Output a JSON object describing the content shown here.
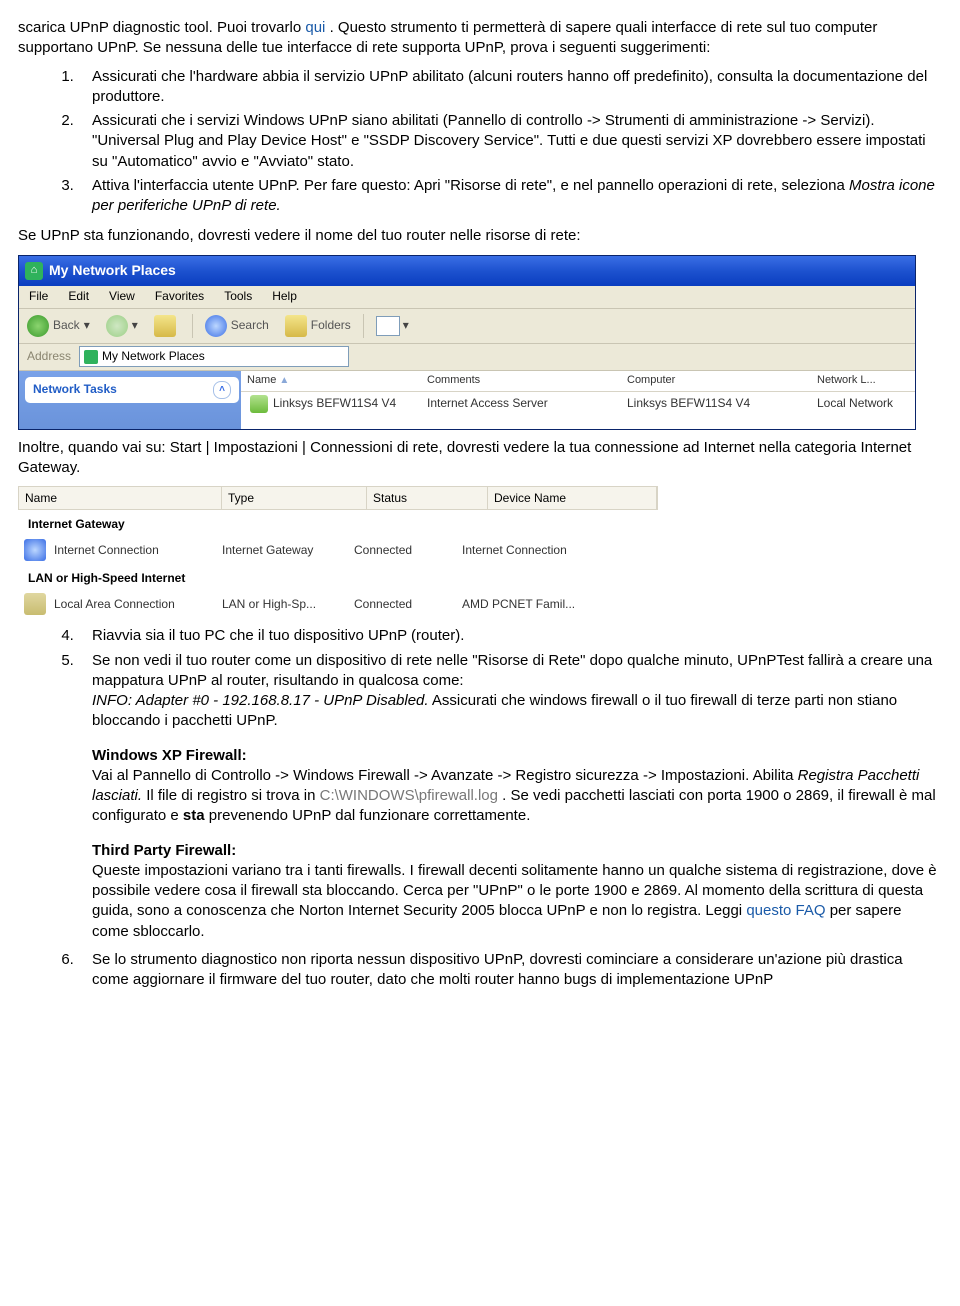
{
  "intro": {
    "part1": "scarica UPnP diagnostic tool. Puoi trovarlo ",
    "link": "qui",
    "part2": ". Questo strumento ti permetterà di sapere quali interfacce di rete sul tuo computer supportano UPnP. Se nessuna delle tue interfacce di rete supporta UPnP, prova i seguenti suggerimenti:"
  },
  "steps": {
    "s1": "Assicurati che l'hardware abbia il servizio UPnP abilitato (alcuni routers hanno off predefinito), consulta la documentazione del produttore.",
    "s2": "Assicurati che i servizi Windows UPnP siano abilitati (Pannello di controllo -> Strumenti di amministrazione -> Servizi). \"Universal Plug and Play Device Host\" e \"SSDP Discovery Service\". Tutti e due questi servizi XP dovrebbero essere impostati su \"Automatico\" avvio e \"Avviato\" stato.",
    "s3a": "Attiva l'interfaccia utente UPnP. Per fare questo: Apri \"Risorse di rete\", e nel pannello operazioni di rete, seleziona ",
    "s3b": "Mostra icone per periferiche UPnP di rete."
  },
  "after_steps": "Se UPnP sta funzionando, dovresti vedere il nome del tuo router nelle risorse di rete:",
  "xp": {
    "title": "My Network Places",
    "menu": [
      "File",
      "Edit",
      "View",
      "Favorites",
      "Tools",
      "Help"
    ],
    "back": "Back",
    "search": "Search",
    "folders": "Folders",
    "address_label": "Address",
    "address_value": "My Network Places",
    "sidebar_title": "Network Tasks",
    "cols": [
      "Name",
      "Comments",
      "Computer",
      "Network L..."
    ],
    "row": {
      "name": "Linksys BEFW11S4 V4",
      "comments": "Internet Access Server",
      "computer": "Linksys BEFW11S4 V4",
      "network": "Local Network"
    }
  },
  "middle_text": "Inoltre, quando vai su: Start | Impostazioni | Connessioni di rete, dovresti vedere la tua connessione ad Internet nella categoria Internet Gateway.",
  "nc": {
    "cols": [
      "Name",
      "Type",
      "Status",
      "Device Name"
    ],
    "cat1": "Internet Gateway",
    "row1": [
      "Internet Connection",
      "Internet Gateway",
      "Connected",
      "Internet Connection"
    ],
    "cat2": "LAN or High-Speed Internet",
    "row2": [
      "Local Area Connection",
      "LAN or High-Sp...",
      "Connected",
      "AMD PCNET Famil..."
    ]
  },
  "steps2": {
    "s4": "Riavvia sia il tuo PC che il tuo dispositivo UPnP (router).",
    "s5a": "Se non vedi il tuo router come un dispositivo di rete nelle \"Risorse di Rete\" dopo qualche minuto, UPnPTest fallirà a creare una mappatura UPnP al router, risultando in qualcosa come:",
    "s5b": "INFO: Adapter #0 - 192.168.8.17 - UPnP Disabled.",
    "s5c": " Assicurati che windows firewall o il tuo firewall di terze parti non stiano bloccando i pacchetti UPnP.",
    "wxp_title": "Windows XP Firewall:",
    "wxp_p1": "Vai al Pannello di Controllo -> Windows Firewall -> Avanzate -> Registro sicurezza -> Impostazioni. Abilita ",
    "wxp_ital": "Registra Pacchetti lasciati.",
    "wxp_p2": " Il file di registro si trova in ",
    "wxp_path": "C:\\WINDOWS\\pfirewall.log",
    "wxp_p3": " . Se vedi pacchetti lasciati con porta 1900 o 2869, il firewall è mal configurato e ",
    "wxp_sta": "sta",
    "wxp_p4": " prevenendo UPnP dal funzionare correttamente.",
    "tp_title": "Third Party Firewall:",
    "tp_p1": "Queste impostazioni variano tra i tanti firewalls. I firewall decenti solitamente hanno un qualche sistema di registrazione, dove è possibile vedere cosa il firewall sta bloccando. Cerca per \"UPnP\" o le porte 1900 e 2869. Al momento della scrittura di questa guida, sono a conoscenza che Norton Internet Security 2005 blocca UPnP e non lo registra. Leggi ",
    "tp_link": "questo FAQ",
    "tp_p2": " per sapere come sbloccarlo.",
    "s6": "Se lo strumento diagnostico non riporta nessun dispositivo UPnP, dovresti cominciare a considerare un'azione più drastica come aggiornare il firmware del tuo router, dato che molti router hanno bugs di implementazione UPnP"
  }
}
